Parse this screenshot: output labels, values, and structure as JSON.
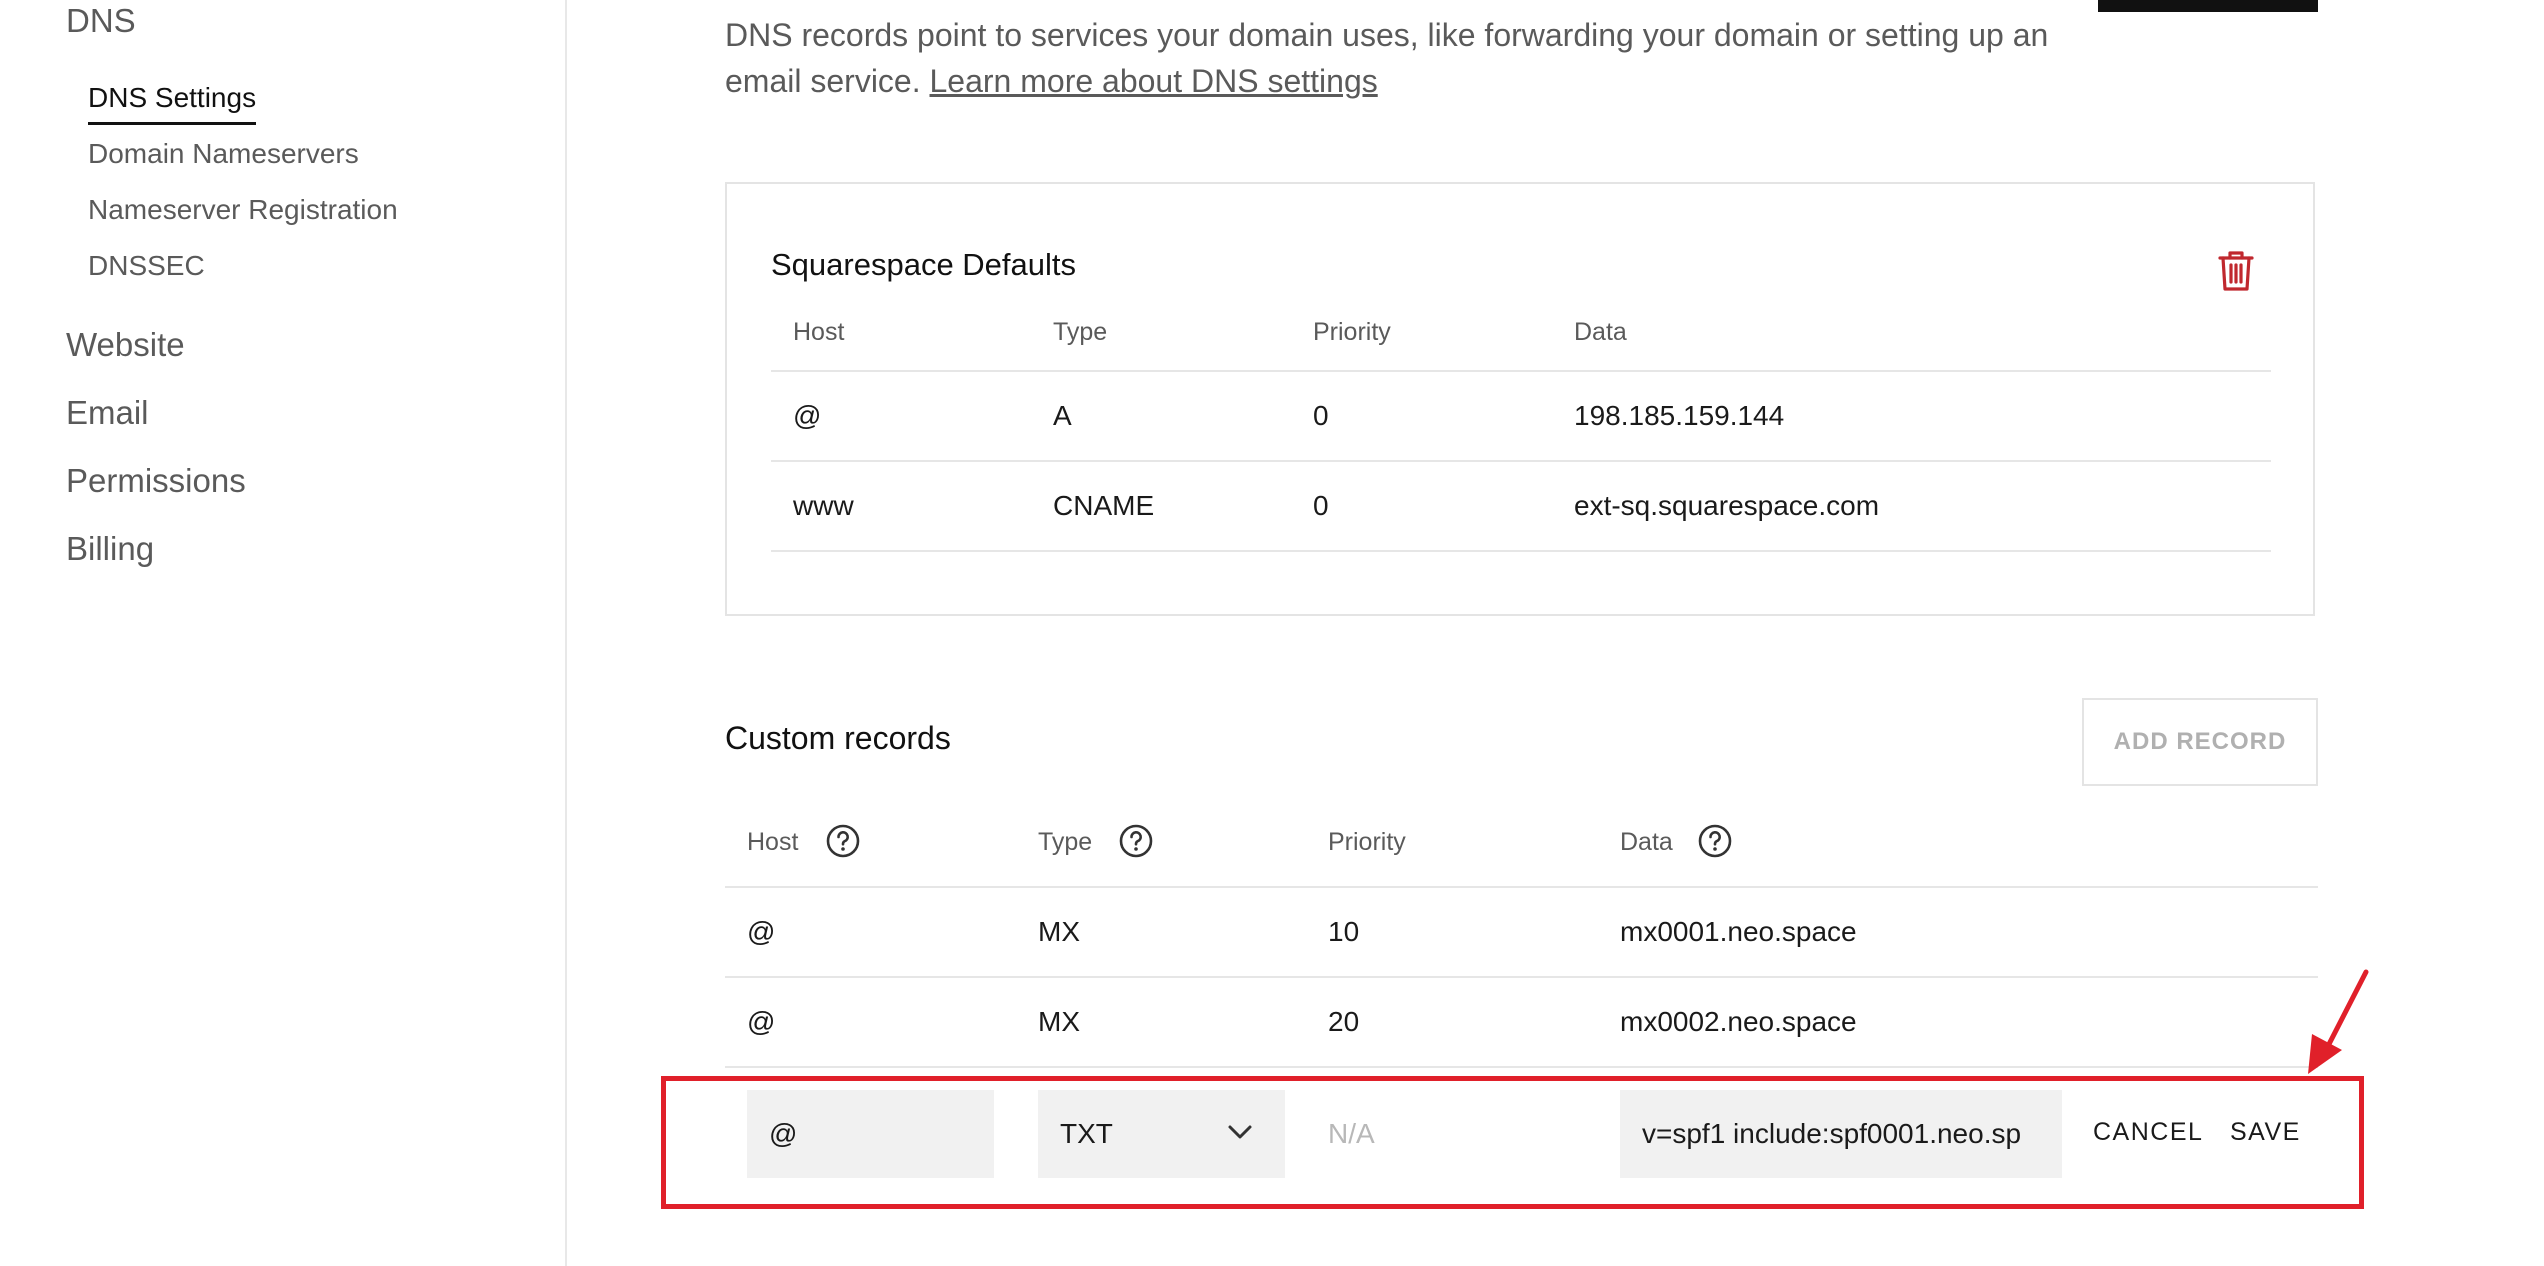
{
  "sidebar": {
    "dns": "DNS",
    "dns_items": [
      "DNS Settings",
      "Domain Nameservers",
      "Nameserver Registration",
      "DNSSEC"
    ],
    "sections": [
      "Website",
      "Email",
      "Permissions",
      "Billing"
    ]
  },
  "intro": {
    "text": "DNS records point to services your domain uses, like forwarding your domain or setting up an email service.",
    "link": "Learn more about DNS settings"
  },
  "defaults": {
    "title": "Squarespace Defaults",
    "headers": [
      "Host",
      "Type",
      "Priority",
      "Data"
    ],
    "rows": [
      [
        "@",
        "A",
        "0",
        "198.185.159.144"
      ],
      [
        "www",
        "CNAME",
        "0",
        "ext-sq.squarespace.com"
      ]
    ]
  },
  "custom": {
    "title": "Custom records",
    "add_label": "ADD RECORD",
    "headers": [
      "Host",
      "Type",
      "Priority",
      "Data"
    ],
    "rows": [
      [
        "@",
        "MX",
        "10",
        "mx0001.neo.space"
      ],
      [
        "@",
        "MX",
        "20",
        "mx0002.neo.space"
      ]
    ],
    "edit": {
      "host": "@",
      "type": "TXT",
      "priority_placeholder": "N/A",
      "data": "v=spf1 include:spf0001.neo.sp",
      "cancel": "CANCEL",
      "save": "SAVE"
    }
  },
  "colors": {
    "highlight": "#e0202a",
    "trash": "#c0282e"
  },
  "icons": [
    "trash-icon",
    "help-icon",
    "chevron-down-icon",
    "arrow-icon"
  ]
}
